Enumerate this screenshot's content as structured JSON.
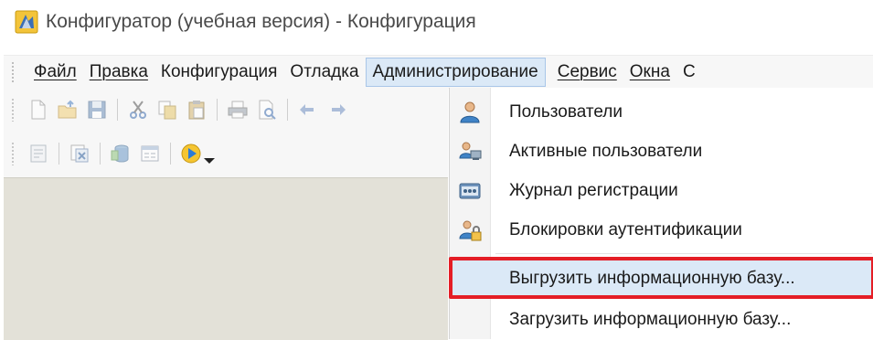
{
  "window": {
    "title": "Конфигуратор (учебная версия) - Конфигурация",
    "app_icon": "1c-configurator-icon"
  },
  "menubar": {
    "items": [
      {
        "label": "Файл",
        "active": false
      },
      {
        "label": "Правка",
        "active": false
      },
      {
        "label": "Конфигурация",
        "active": false
      },
      {
        "label": "Отладка",
        "active": false
      },
      {
        "label": "Администрирование",
        "active": true
      },
      {
        "label": "Сервис",
        "active": false
      },
      {
        "label": "Окна",
        "active": false
      },
      {
        "label": "С",
        "active": false
      }
    ]
  },
  "toolbar": {
    "row1_icons": [
      "new-document-icon",
      "open-icon",
      "save-icon",
      "cut-icon",
      "copy-icon",
      "paste-icon",
      "print-icon",
      "print-preview-icon",
      "undo-icon",
      "redo-icon"
    ],
    "row2_icons": [
      "module-icon",
      "compare-icon",
      "database-icon",
      "form-icon",
      "run-debug-icon"
    ]
  },
  "admin_menu": {
    "items": [
      {
        "label": "Пользователи",
        "icon": "user-icon",
        "highlighted": false
      },
      {
        "label": "Активные пользователи",
        "icon": "active-users-icon",
        "highlighted": false
      },
      {
        "label": "Журнал регистрации",
        "icon": "event-log-icon",
        "highlighted": false
      },
      {
        "label": "Блокировки аутентификации",
        "icon": "user-lock-icon",
        "highlighted": false
      },
      {
        "label": "Выгрузить информационную базу...",
        "icon": "",
        "highlighted": true
      },
      {
        "label": "Загрузить информационную базу...",
        "icon": "",
        "highlighted": false
      }
    ]
  },
  "colors": {
    "highlight": "#dbe9f7",
    "annotation_frame": "#e41e26"
  }
}
